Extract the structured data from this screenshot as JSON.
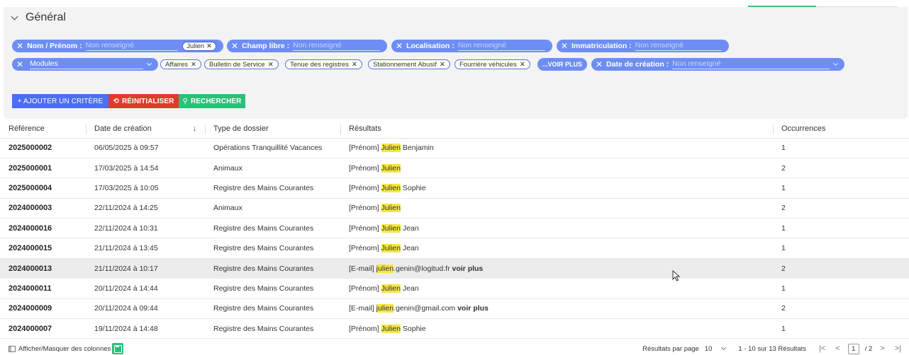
{
  "filters": {
    "section_title": "Général",
    "nom": {
      "label": "Nom / Prénom :",
      "placeholder": "Non renseigné",
      "chip": "Julien"
    },
    "champ_libre": {
      "label": "Champ libre :",
      "placeholder": "Non renseigné"
    },
    "localisation": {
      "label": "Localisation :",
      "placeholder": "Non renseigné"
    },
    "immatriculation": {
      "label": "Immatriculation :",
      "placeholder": "Non renseigné"
    },
    "modules": {
      "value": "Modules",
      "chips": [
        "Affaires",
        "Bulletin de Service",
        "Tenue des registres",
        "Stationnement Abusif",
        "Fourrière véhicules"
      ],
      "voir_plus": "...VOIR PLUS"
    },
    "date_creation": {
      "label": "Date de création :",
      "placeholder": "Non renseigné"
    }
  },
  "actions": {
    "add": "+ AJOUTER UN CRITÈRE",
    "reset": "RÉINITIALISER",
    "search": "RECHERCHER"
  },
  "table": {
    "columns": [
      "Référence",
      "Date de création",
      "Type de dossier",
      "Résultats",
      "Occurrences"
    ],
    "sort_indicator": "↓",
    "rows": [
      {
        "ref": "2025000002",
        "date": "06/05/2025 à 09:57",
        "type": "Opérations Tranquillité Vacances",
        "prefix": "[Prénom]",
        "match": "Julien",
        "rest": "Benjamin",
        "more": "",
        "occ": "1"
      },
      {
        "ref": "2025000001",
        "date": "17/03/2025 à 14:54",
        "type": "Animaux",
        "prefix": "[Prénom]",
        "match": "Julien",
        "rest": "",
        "more": "",
        "occ": "2"
      },
      {
        "ref": "2025000004",
        "date": "17/03/2025 à 10:05",
        "type": "Registre des Mains Courantes",
        "prefix": "[Prénom]",
        "match": "Julien",
        "rest": " Sophie",
        "more": "",
        "occ": "1"
      },
      {
        "ref": "2024000003",
        "date": "22/11/2024 à 14:25",
        "type": "Animaux",
        "prefix": "[Prénom]",
        "match": "Julien",
        "rest": "",
        "more": "",
        "occ": "2"
      },
      {
        "ref": "2024000016",
        "date": "22/11/2024 à 10:31",
        "type": "Registre des Mains Courantes",
        "prefix": "[Prénom]",
        "match": "Julien",
        "rest": " Jean",
        "more": "",
        "occ": "1"
      },
      {
        "ref": "2024000015",
        "date": "21/11/2024 à 13:45",
        "type": "Registre des Mains Courantes",
        "prefix": "[Prénom]",
        "match": "Julien",
        "rest": " Jean",
        "more": "",
        "occ": "1"
      },
      {
        "ref": "2024000013",
        "date": "21/11/2024 à 10:17",
        "type": "Registre des Mains Courantes",
        "prefix": "[E-mail]",
        "match": "julien",
        "rest": ".genin@logitud.fr",
        "more": "voir plus",
        "occ": "2"
      },
      {
        "ref": "2024000011",
        "date": "20/11/2024 à 14:44",
        "type": "Registre des Mains Courantes",
        "prefix": "[Prénom]",
        "match": "Julien",
        "rest": " Jean",
        "more": "",
        "occ": "1"
      },
      {
        "ref": "2024000009",
        "date": "20/11/2024 à 09:44",
        "type": "Registre des Mains Courantes",
        "prefix": "[E-mail]",
        "match": "julien",
        "rest": ".genin@gmail.com",
        "more": "voir plus",
        "occ": "2"
      },
      {
        "ref": "2024000007",
        "date": "19/11/2024 à 14:48",
        "type": "Registre des Mains Courantes",
        "prefix": "[Prénom]",
        "match": "Julien",
        "rest": " Sophie",
        "more": "",
        "occ": "1"
      }
    ]
  },
  "footer": {
    "columns_toggle": "Afficher/Masquer des colonnes",
    "per_page_label": "Résultats par page",
    "per_page_value": "10",
    "range": "1 - 10 sur 13 Résultats",
    "current_page": "1",
    "total_pages": "/ 2"
  }
}
